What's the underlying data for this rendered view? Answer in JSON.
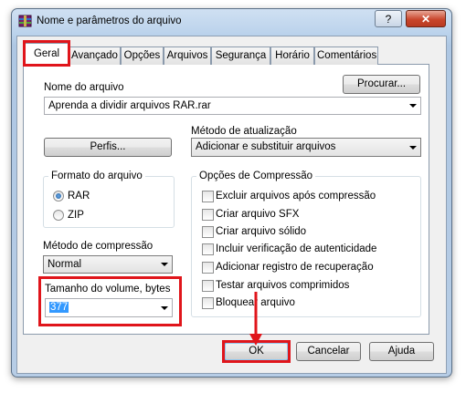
{
  "window": {
    "title": "Nome e parâmetros do arquivo",
    "help_button": "?",
    "close_button": "✕"
  },
  "tabs": [
    {
      "label": "Geral",
      "active": true
    },
    {
      "label": "Avançado"
    },
    {
      "label": "Opções"
    },
    {
      "label": "Arquivos"
    },
    {
      "label": "Segurança"
    },
    {
      "label": "Horário"
    },
    {
      "label": "Comentários"
    }
  ],
  "general": {
    "archive_name_label": "Nome do arquivo",
    "browse_button": "Procurar...",
    "archive_name_value": "Aprenda a dividir arquivos RAR.rar",
    "profiles_button": "Perfis...",
    "update_method_label": "Método de atualização",
    "update_method_value": "Adicionar e substituir arquivos",
    "archive_format": {
      "title": "Formato do arquivo",
      "options": [
        "RAR",
        "ZIP"
      ],
      "selected": "RAR"
    },
    "compression_method_label": "Método de compressão",
    "compression_method_value": "Normal",
    "volume_size_label": "Tamanho do volume, bytes",
    "volume_size_value": "377",
    "compression_options": {
      "title": "Opções de Compressão",
      "items": [
        {
          "label": "Excluir arquivos após compressão",
          "checked": false
        },
        {
          "label": "Criar arquivo SFX",
          "checked": false
        },
        {
          "label": "Criar arquivo sólido",
          "checked": false
        },
        {
          "label": "Incluir verificação de autenticidade",
          "checked": false
        },
        {
          "label": "Adicionar registro de recuperação",
          "checked": false
        },
        {
          "label": "Testar arquivos comprimidos",
          "checked": false
        },
        {
          "label": "Bloquear arquivo",
          "checked": false
        }
      ]
    }
  },
  "footer": {
    "ok_button": "OK",
    "cancel_button": "Cancelar",
    "help_button": "Ajuda"
  },
  "annotation_color": "#e0151b"
}
